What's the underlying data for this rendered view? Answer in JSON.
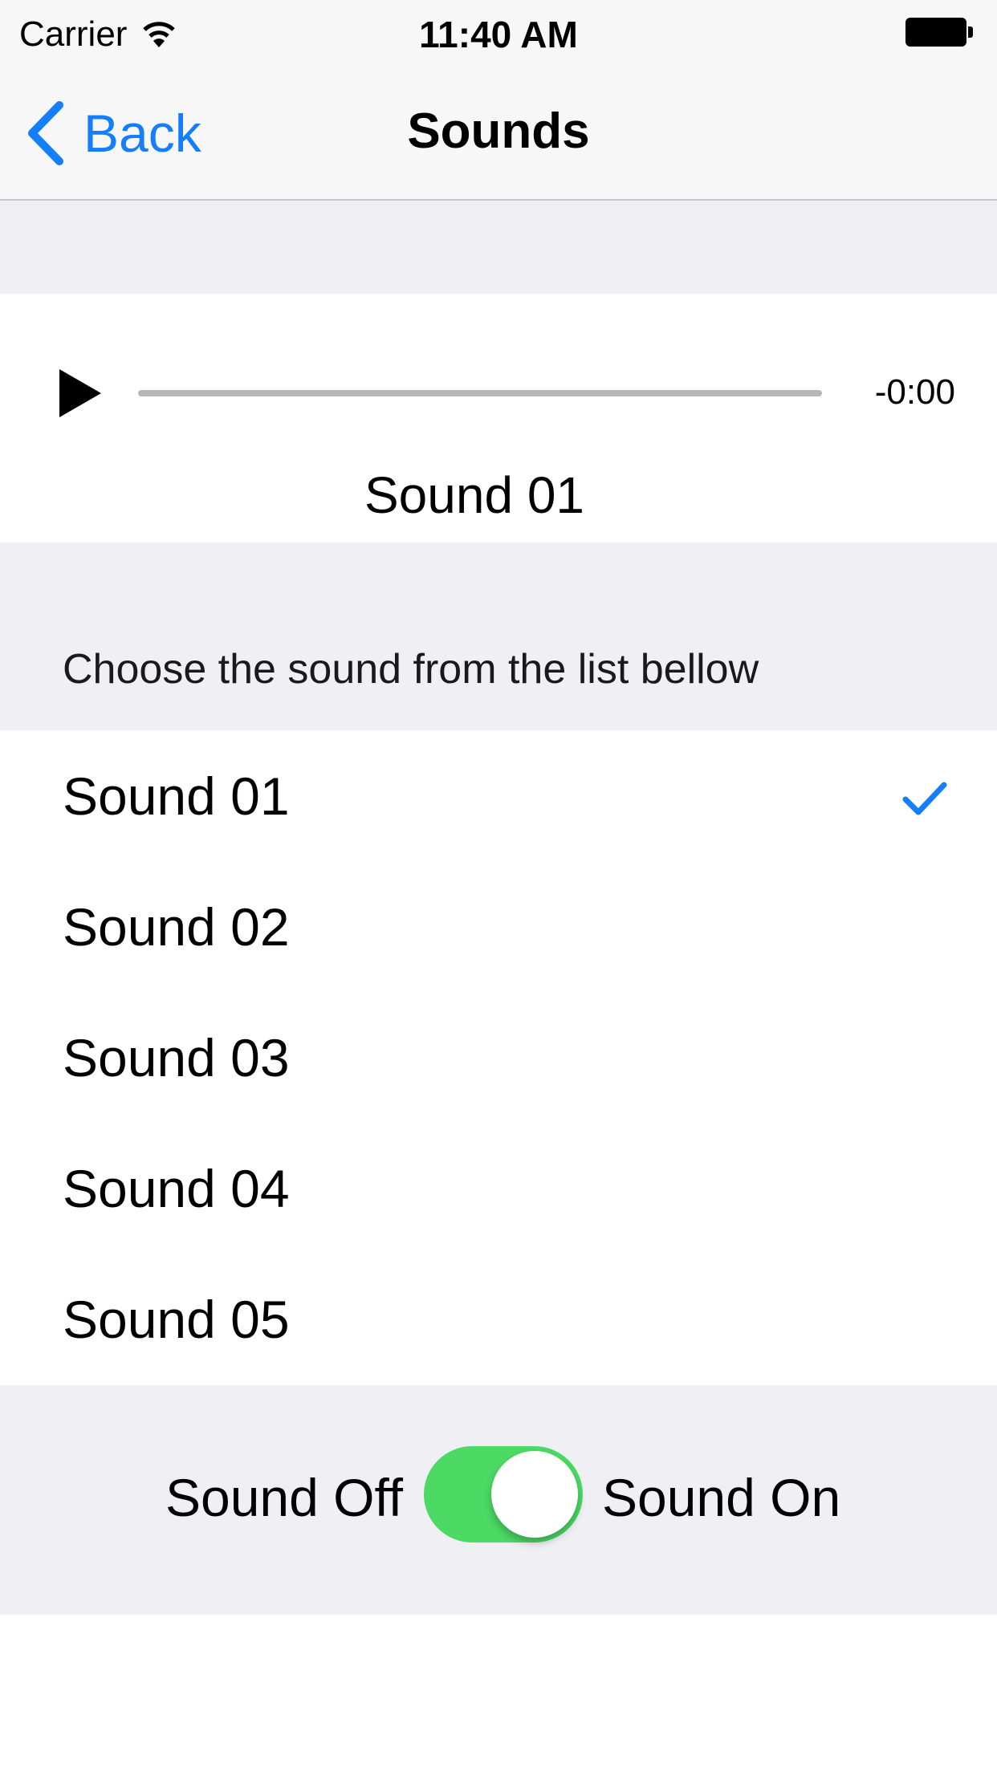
{
  "status_bar": {
    "carrier": "Carrier",
    "time": "11:40 AM"
  },
  "nav": {
    "back_label": "Back",
    "title": "Sounds"
  },
  "player": {
    "time_remaining": "-0:00",
    "now_playing": "Sound 01",
    "progress": 0
  },
  "section_hint": "Choose the sound from the list bellow",
  "sounds": [
    {
      "label": "Sound 01",
      "selected": true
    },
    {
      "label": "Sound 02",
      "selected": false
    },
    {
      "label": "Sound 03",
      "selected": false
    },
    {
      "label": "Sound 04",
      "selected": false
    },
    {
      "label": "Sound 05",
      "selected": false
    }
  ],
  "sound_toggle": {
    "off_label": "Sound Off",
    "on_label": "Sound On",
    "on": true
  },
  "colors": {
    "accent": "#157efb",
    "switch_on": "#4cd964",
    "group_bg": "#efeff4"
  }
}
